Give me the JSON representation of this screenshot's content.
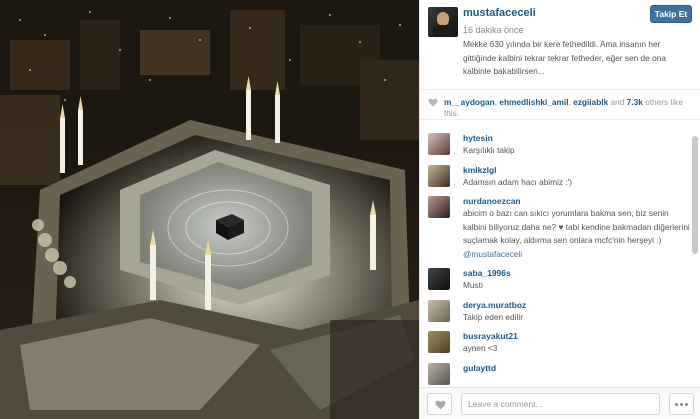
{
  "post": {
    "username": "mustafaceceli",
    "follow_label": "Takip Et",
    "time": "16 dakika önce",
    "caption": "Mekke 630 yılında bir kere fethedildi. Ama insanın her gittiğinde kalbini tekrar tekrar fetheder, eğer sen de ona kalbinle bakabilirsen..."
  },
  "likes": {
    "users": [
      "m__aydogan",
      "ehmedlishki_amil",
      "ezgiiablk"
    ],
    "sep1": ", ",
    "sep2": ", ",
    "sep3": " and ",
    "count": "7.3k",
    "suffix": " others like this."
  },
  "comments": [
    {
      "user": "hytesin",
      "text": "Karşılıklı takip"
    },
    {
      "user": "kmlkzlgl",
      "text": "Adamsın adam hacı abimiz :')"
    },
    {
      "user": "nurdanoezcan",
      "text": "abicim o bazı can sıkıcı yorumlara bakma sen, biz senin kalbini biliyoruz daha ne? ♥ tabi kendine bakmadan diğerlerini suçlamak kolay, aldırma sen onlara mcfc'nin herşeyi :) ",
      "mention": "@mustafaceceli"
    },
    {
      "user": "saba_1996s",
      "text": "Musti"
    },
    {
      "user": "derya.muratboz",
      "text": "Takip eden edilir"
    },
    {
      "user": "busrayakut21",
      "text": "aynen <3"
    },
    {
      "user": "gulayttd",
      "text": ""
    }
  ],
  "composer": {
    "placeholder": "Leave a comment..."
  },
  "icons": {
    "like": "heart-icon",
    "more": "more-dots-icon"
  },
  "colors": {
    "brand_blue": "#3f729b",
    "username_blue": "#1f5a86"
  }
}
